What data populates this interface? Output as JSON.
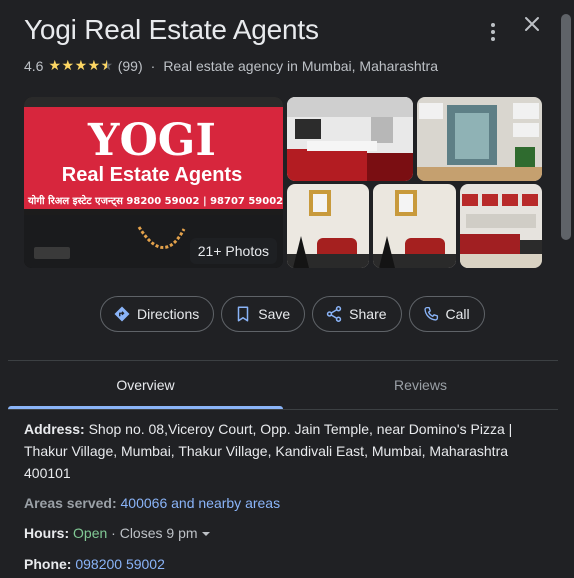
{
  "business": {
    "name": "Yogi Real Estate Agents",
    "rating": "4.6",
    "reviews_count": "(99)",
    "separator": "·",
    "category": "Real estate agency in Mumbai, Maharashtra",
    "stars_filled": 4.5,
    "star_color": "#fdd663"
  },
  "header": {
    "more_icon": "more-vert-icon",
    "close_icon": "close-icon"
  },
  "photos": {
    "count_label": "21+ Photos",
    "sign": {
      "line1": "YOGI",
      "line2": "Real Estate Agents",
      "line3": "योगी रिअल इस्टेट एजन्ट्स 98200 59002 | 98707 59002"
    }
  },
  "actions": [
    {
      "label": "Directions",
      "icon": "directions-icon"
    },
    {
      "label": "Save",
      "icon": "bookmark-icon"
    },
    {
      "label": "Share",
      "icon": "share-icon"
    },
    {
      "label": "Call",
      "icon": "phone-icon"
    }
  ],
  "tabs": {
    "overview": "Overview",
    "reviews": "Reviews",
    "accent": "#8ab4f8"
  },
  "details": {
    "address_label": "Address:",
    "address_value": "Shop no. 08,Viceroy Court, Opp. Jain Temple, near Domino's Pizza | Thakur Village, Mumbai, Thakur Village, Kandivali East, Mumbai, Maharashtra 400101",
    "areas_label": "Areas served:",
    "areas_value": "400066 and nearby areas",
    "hours_label": "Hours:",
    "hours_status": "Open",
    "hours_close": "· Closes 9 pm",
    "phone_label": "Phone:",
    "phone_value": "098200 59002"
  },
  "colors": {
    "background": "#202124",
    "link": "#8ab4f8",
    "open": "#81c995",
    "sign_red": "#d7263d"
  }
}
